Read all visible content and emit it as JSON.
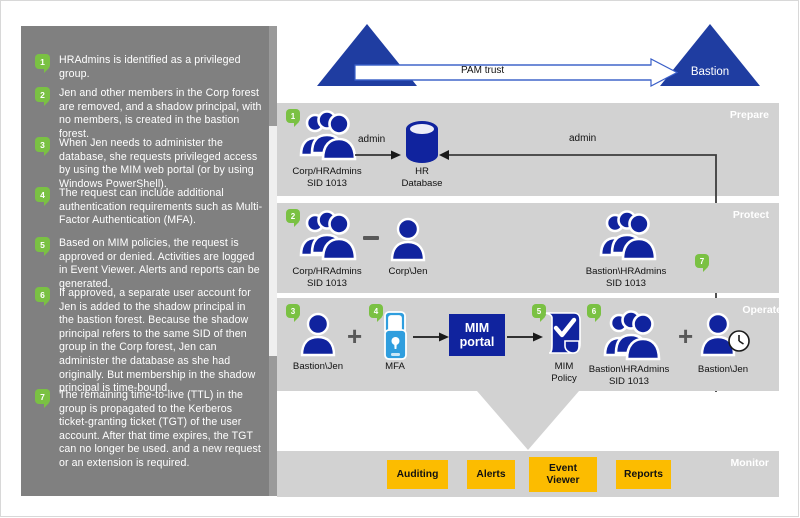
{
  "legend": {
    "items": [
      {
        "num": "1",
        "text": "HRAdmins is identified as a privileged group."
      },
      {
        "num": "2",
        "text": "Jen and other members in the Corp forest are removed, and a shadow principal, with no members, is created in the bastion forest."
      },
      {
        "num": "3",
        "text": "When Jen needs to administer the database, she requests privileged access by using the MIM web portal (or by using Windows PowerShell)."
      },
      {
        "num": "4",
        "text": "The request can include additional authentication requirements such as Multi-Factor Authentication (MFA)."
      },
      {
        "num": "5",
        "text": "Based on MIM policies, the request is approved or denied. Activities are logged in Event Viewer. Alerts and reports can be generated."
      },
      {
        "num": "6",
        "text": "If approved, a separate user account for Jen is added to the shadow principal in the bastion forest. Because the shadow principal refers to the same SID of then group in the Corp forest, Jen can administer the database as she had originally. But membership in the shadow principal is time-bound."
      },
      {
        "num": "7",
        "text": "The remaining time-to-live (TTL) in the group is propagated to the Kerberos ticket-granting ticket (TGT) of the user account. After that time expires, the TGT can no longer be used. and a new request or an extension is required."
      }
    ]
  },
  "trust": {
    "left_forest": "Corp",
    "right_forest": "Bastion",
    "arrow_label": "PAM trust"
  },
  "bands": {
    "prepare": {
      "title": "Prepare",
      "badge": "1",
      "group_label": "Corp/HRAdmins\nSID 1013",
      "db_label": "HR\nDatabase",
      "edge_admin_left": "admin",
      "edge_admin_right": "admin"
    },
    "protect": {
      "title": "Protect",
      "badge_left": "2",
      "badge_right": "7",
      "group_label": "Corp/HRAdmins\nSID 1013",
      "user_label": "Corp\\Jen",
      "shadow_label": "Bastion\\HRAdmins\nSID 1013"
    },
    "operate": {
      "title": "Operate",
      "badge_user": "3",
      "badge_mfa": "4",
      "badge_policy": "5",
      "badge_group": "6",
      "user_label": "Bastion\\Jen",
      "mfa_label": "MFA",
      "portal_label": "MIM\nportal",
      "policy_label": "MIM\nPolicy",
      "group_label": "Bastion\\HRAdmins\nSID 1013",
      "timed_user_label": "Bastion\\Jen",
      "plus_1": "+",
      "plus_2": "+"
    },
    "monitor": {
      "title": "Monitor",
      "buttons": [
        {
          "label": "Auditing"
        },
        {
          "label": "Alerts"
        },
        {
          "label": "Event\nViewer"
        },
        {
          "label": "Reports"
        }
      ]
    }
  },
  "colors": {
    "brand_blue": "#10239e",
    "trust_blue": "#1f3da1",
    "badge_green": "#7ac143",
    "band_gray": "#d2d2d2",
    "panel_gray": "#808080",
    "accent_yellow": "#fcbc00",
    "mfa_blue": "#2f9ede"
  }
}
